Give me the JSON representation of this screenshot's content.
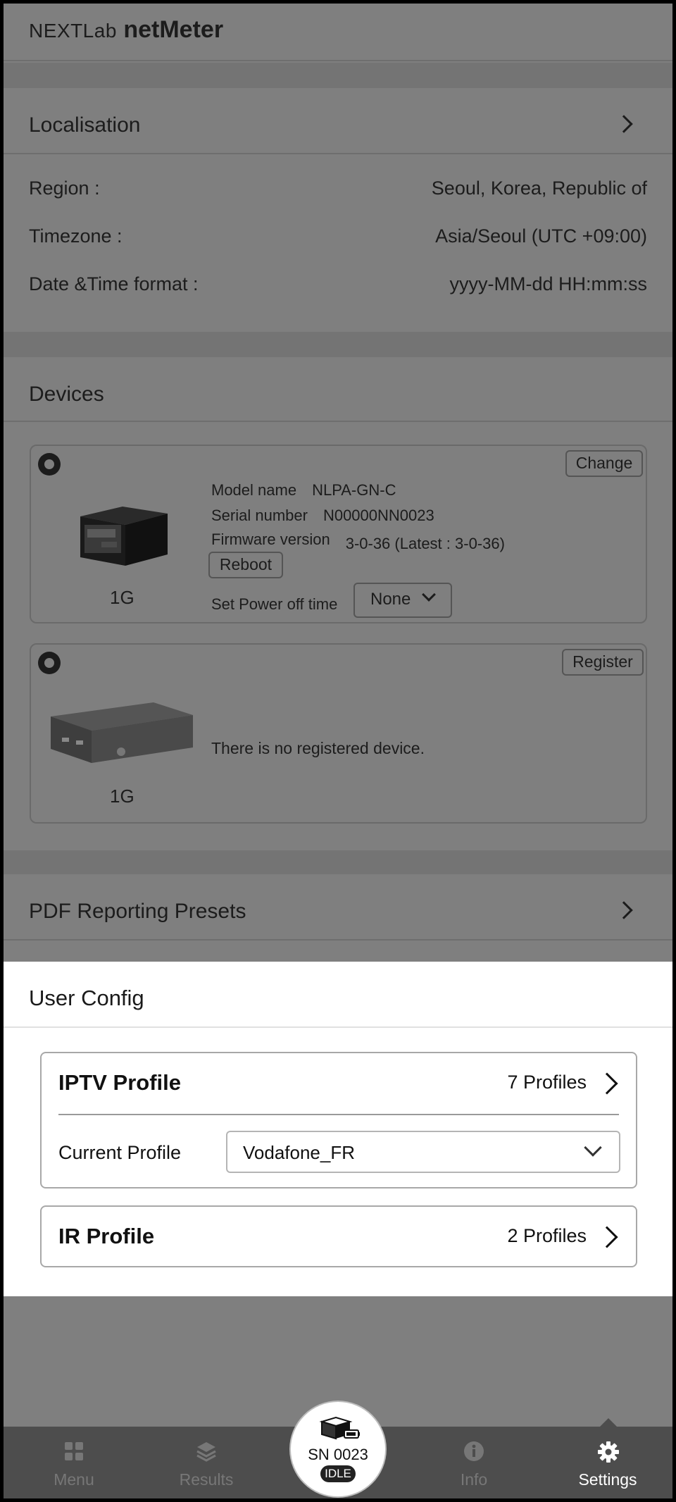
{
  "app": {
    "brand_prefix": "NEXTLab",
    "brand_name": "netMeter"
  },
  "localisation": {
    "title": "Localisation",
    "rows": [
      {
        "label": "Region :",
        "value": "Seoul, Korea, Republic of"
      },
      {
        "label": "Timezone :",
        "value": "Asia/Seoul (UTC +09:00)"
      },
      {
        "label": "Date &Time format :",
        "value": "yyyy-MM-dd HH:mm:ss"
      }
    ]
  },
  "devices": {
    "title": "Devices",
    "device1": {
      "change_label": "Change",
      "type_label": "1G",
      "model_label": "Model name",
      "model_value": "NLPA-GN-C",
      "serial_label": "Serial number",
      "serial_value": "N00000NN0023",
      "firmware_label": "Firmware version",
      "firmware_value": "3-0-36 (Latest : 3-0-36)",
      "reboot_label": "Reboot",
      "power_off_label": "Set Power off time",
      "power_off_value": "None"
    },
    "device2": {
      "register_label": "Register",
      "type_label": "1G",
      "empty_text": "There is no registered device."
    }
  },
  "pdf": {
    "title": "PDF Reporting Presets"
  },
  "user_config": {
    "title": "User Config",
    "iptv": {
      "title": "IPTV Profile",
      "count": "7 Profiles",
      "current_label": "Current Profile",
      "current_value": "Vodafone_FR"
    },
    "ir": {
      "title": "IR Profile",
      "count": "2 Profiles"
    }
  },
  "device_status": {
    "serial": "SN 0023",
    "state": "IDLE"
  },
  "nav": {
    "menu": "Menu",
    "results": "Results",
    "info": "Info",
    "settings": "Settings",
    "active": "settings"
  },
  "colors": {
    "overlay": "#7f7f7f",
    "sheet": "#ffffff",
    "nav_bg": "#4d4d4d",
    "nav_active": "#ffffff"
  }
}
